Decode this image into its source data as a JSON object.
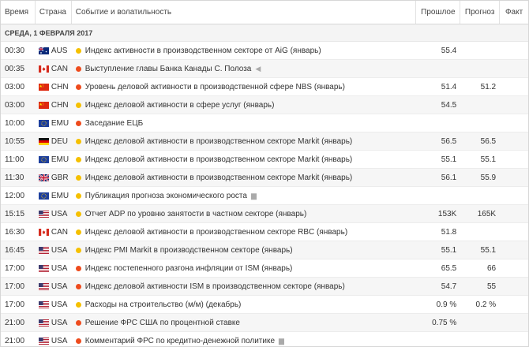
{
  "header": {
    "time": "Время",
    "country": "Страна",
    "event": "Событие и волатильность",
    "previous": "Прошлое",
    "forecast": "Прогноз",
    "fact": "Факт"
  },
  "date": "СРЕДА, 1 ФЕВРАЛЯ 2017",
  "colors": {
    "medium": "#f5c000",
    "high": "#ee4b1d",
    "border": "#d6d6d6"
  },
  "events": [
    {
      "time": "00:30",
      "country": "AUS",
      "flag": "aus-flag",
      "vol": "medium",
      "title": "Индекс активности в производственном секторе от AiG (январь)",
      "suffix": "",
      "previous": "55.4",
      "forecast": "",
      "fact": ""
    },
    {
      "time": "00:35",
      "country": "CAN",
      "flag": "can-flag",
      "vol": "high",
      "title": "Выступление главы Банка Канады С. Полоза",
      "suffix": "◀",
      "previous": "",
      "forecast": "",
      "fact": ""
    },
    {
      "time": "03:00",
      "country": "CHN",
      "flag": "chn-flag",
      "vol": "high",
      "title": "Уровень деловой активности в производственной сфере NBS (январь)",
      "suffix": "",
      "previous": "51.4",
      "forecast": "51.2",
      "fact": ""
    },
    {
      "time": "03:00",
      "country": "CHN",
      "flag": "chn-flag",
      "vol": "medium",
      "title": "Индекс деловой активности в сфере услуг (январь)",
      "suffix": "",
      "previous": "54.5",
      "forecast": "",
      "fact": ""
    },
    {
      "time": "10:00",
      "country": "EMU",
      "flag": "emu-flag",
      "vol": "high",
      "title": "Заседание ЕЦБ",
      "suffix": "",
      "previous": "",
      "forecast": "",
      "fact": ""
    },
    {
      "time": "10:55",
      "country": "DEU",
      "flag": "deu-flag",
      "vol": "medium",
      "title": "Индекс деловой активности в производственном секторе Markit (январь)",
      "suffix": "",
      "previous": "56.5",
      "forecast": "56.5",
      "fact": ""
    },
    {
      "time": "11:00",
      "country": "EMU",
      "flag": "emu-flag",
      "vol": "medium",
      "title": "Индекс деловой активности в производственном секторе Markit (январь)",
      "suffix": "",
      "previous": "55.1",
      "forecast": "55.1",
      "fact": ""
    },
    {
      "time": "11:30",
      "country": "GBR",
      "flag": "gbr-flag",
      "vol": "medium",
      "title": "Индекс деловой активности в производственном секторе Markit (январь)",
      "suffix": "",
      "previous": "56.1",
      "forecast": "55.9",
      "fact": ""
    },
    {
      "time": "12:00",
      "country": "EMU",
      "flag": "emu-flag",
      "vol": "medium",
      "title": "Публикация прогноза экономического роста",
      "suffix": "▆",
      "previous": "",
      "forecast": "",
      "fact": ""
    },
    {
      "time": "15:15",
      "country": "USA",
      "flag": "usa-flag",
      "vol": "medium",
      "title": "Отчет ADP по уровню занятости в частном секторе (январь)",
      "suffix": "",
      "previous": "153K",
      "forecast": "165K",
      "fact": ""
    },
    {
      "time": "16:30",
      "country": "CAN",
      "flag": "can-flag",
      "vol": "medium",
      "title": "Индекс деловой активности в производственном секторе RBC (январь)",
      "suffix": "",
      "previous": "51.8",
      "forecast": "",
      "fact": ""
    },
    {
      "time": "16:45",
      "country": "USA",
      "flag": "usa-flag",
      "vol": "medium",
      "title": "Индекс PMI Markit в производственном секторе (январь)",
      "suffix": "",
      "previous": "55.1",
      "forecast": "55.1",
      "fact": ""
    },
    {
      "time": "17:00",
      "country": "USA",
      "flag": "usa-flag",
      "vol": "high",
      "title": "Индекс постепенного разгона инфляции от ISM (январь)",
      "suffix": "",
      "previous": "65.5",
      "forecast": "66",
      "fact": ""
    },
    {
      "time": "17:00",
      "country": "USA",
      "flag": "usa-flag",
      "vol": "high",
      "title": "Индекс деловой активности ISM в производственном секторе (январь)",
      "suffix": "",
      "previous": "54.7",
      "forecast": "55",
      "fact": ""
    },
    {
      "time": "17:00",
      "country": "USA",
      "flag": "usa-flag",
      "vol": "medium",
      "title": "Расходы на строительство (м/м) (декабрь)",
      "suffix": "",
      "previous": "0.9 %",
      "forecast": "0.2 %",
      "fact": ""
    },
    {
      "time": "21:00",
      "country": "USA",
      "flag": "usa-flag",
      "vol": "high",
      "title": "Решение ФРС США по процентной ставке",
      "suffix": "",
      "previous": "0.75 %",
      "forecast": "",
      "fact": ""
    },
    {
      "time": "21:00",
      "country": "USA",
      "flag": "usa-flag",
      "vol": "high",
      "title": "Комментарий ФРС по кредитно-денежной политике",
      "suffix": "▆",
      "previous": "",
      "forecast": "",
      "fact": ""
    }
  ]
}
